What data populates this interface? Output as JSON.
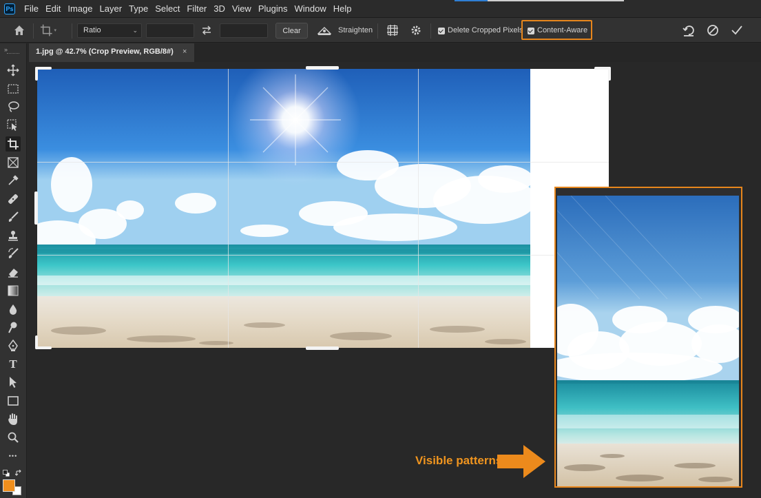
{
  "app": {
    "logo_text": "Ps"
  },
  "menu": [
    "File",
    "Edit",
    "Image",
    "Layer",
    "Type",
    "Select",
    "Filter",
    "3D",
    "View",
    "Plugins",
    "Window",
    "Help"
  ],
  "options": {
    "ratio_value": "Ratio",
    "width_value": "",
    "height_value": "",
    "clear_label": "Clear",
    "straighten_label": "Straighten",
    "delete_cropped_label": "Delete Cropped Pixels",
    "delete_cropped_checked": true,
    "content_aware_label": "Content-Aware",
    "content_aware_checked": true
  },
  "document_tab": {
    "title": "1.jpg @ 42.7% (Crop Preview, RGB/8#)",
    "close_glyph": "×"
  },
  "tools": [
    "move-icon",
    "marquee-icon",
    "lasso-icon",
    "object-select-icon",
    "crop-icon",
    "frame-icon",
    "eyedropper-icon",
    "healing-icon",
    "brush-icon",
    "stamp-icon",
    "history-brush-icon",
    "eraser-icon",
    "gradient-icon",
    "blur-icon",
    "dodge-icon",
    "pen-icon",
    "type-icon",
    "path-select-icon",
    "rectangle-icon",
    "hand-icon",
    "zoom-icon",
    "more-icon"
  ],
  "type_tool_glyph": "T",
  "more_glyph": "•••",
  "colors": {
    "foreground": "#f08f1d",
    "background": "#ffffff",
    "accent": "#e8861c"
  },
  "annotation": {
    "text": "Visible patterns"
  }
}
